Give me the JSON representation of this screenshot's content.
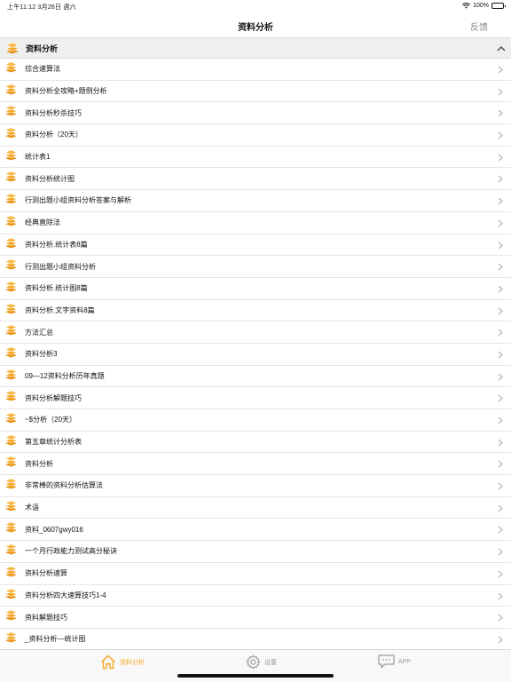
{
  "status_bar": {
    "time_date": "上午11:12  3月26日 週六",
    "battery": "100%"
  },
  "nav": {
    "title": "资料分析",
    "feedback": "反馈"
  },
  "section": {
    "title": "资料分析",
    "accent_color": "#f5a623"
  },
  "items": [
    "综合速算法",
    "资料分析全攻略+题例分析",
    "资料分析秒杀技巧",
    "资料分析（20天）",
    "统计表1",
    "资料分析统计图",
    "行测出题小组资料分析答案与解析",
    "经典直除法",
    "资料分析.统计表8篇",
    "行测出题小组资料分析",
    "资料分析.统计图8篇",
    "资料分析.文字资料8篇",
    "方法汇总",
    "资料分析3",
    "09—12资料分析历年真题",
    "资料分析解题技巧",
    "~$分析（20天）",
    "第五章统计分析表",
    "资料分析",
    "非常棒的资料分析估算法",
    "术语",
    "资料_0607gwy016",
    "一个月行政能力测试高分秘诀",
    "资料分析速算",
    "资料分析四大速算技巧1-4",
    "资料解题技巧",
    "_资料分析—统计图"
  ],
  "tabs": [
    {
      "label": "资料分析",
      "icon": "home-icon",
      "active": true
    },
    {
      "label": "设置",
      "icon": "gear-icon",
      "active": false
    },
    {
      "label": "APP",
      "icon": "chat-bubble-icon",
      "active": false
    }
  ]
}
